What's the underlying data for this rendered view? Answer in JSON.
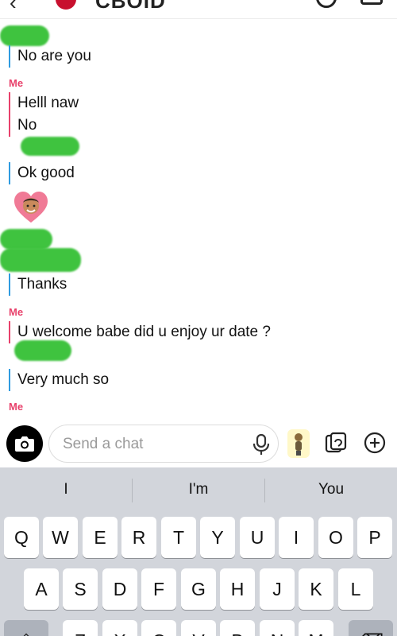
{
  "header": {
    "title": "CBOID",
    "back_glyph": "‹"
  },
  "messages": [
    {
      "sender": "",
      "text": "No are you",
      "side": "them"
    },
    {
      "sender": "Me",
      "text": "Helll naw",
      "side": "me"
    },
    {
      "sender": "",
      "text": "No",
      "side": "me"
    },
    {
      "sender": "",
      "text": "Ok good",
      "side": "them"
    },
    {
      "sender": "",
      "text": "Thanks",
      "side": "them"
    },
    {
      "sender": "Me",
      "text": "U welcome babe did u enjoy ur date ?",
      "side": "me"
    },
    {
      "sender": "",
      "text": "Very much so",
      "side": "them"
    },
    {
      "sender": "Me",
      "text": "",
      "side": "me"
    }
  ],
  "labels": {
    "me_1": "Me",
    "me_2": "Me",
    "me_3": "Me"
  },
  "composer": {
    "placeholder": "Send a chat"
  },
  "keyboard": {
    "suggestions": [
      "I",
      "I'm",
      "You"
    ],
    "row1": [
      "Q",
      "W",
      "E",
      "R",
      "T",
      "Y",
      "U",
      "I",
      "O",
      "P"
    ],
    "row2": [
      "A",
      "S",
      "D",
      "F",
      "G",
      "H",
      "J",
      "K",
      "L"
    ],
    "row3": [
      "⇧",
      "Z",
      "X",
      "C",
      "V",
      "B",
      "N",
      "M",
      "⌫"
    ]
  },
  "colors": {
    "me_accent": "#e8416b",
    "friend_accent": "#2f9be0",
    "redaction": "#3fc33f",
    "keyboard_bg": "#d2d5db"
  },
  "icons": {
    "camera": "camera-icon",
    "mic": "microphone-icon",
    "stickers": "sticker-icon",
    "memories": "memories-icon",
    "plus": "plus-circle-icon"
  }
}
